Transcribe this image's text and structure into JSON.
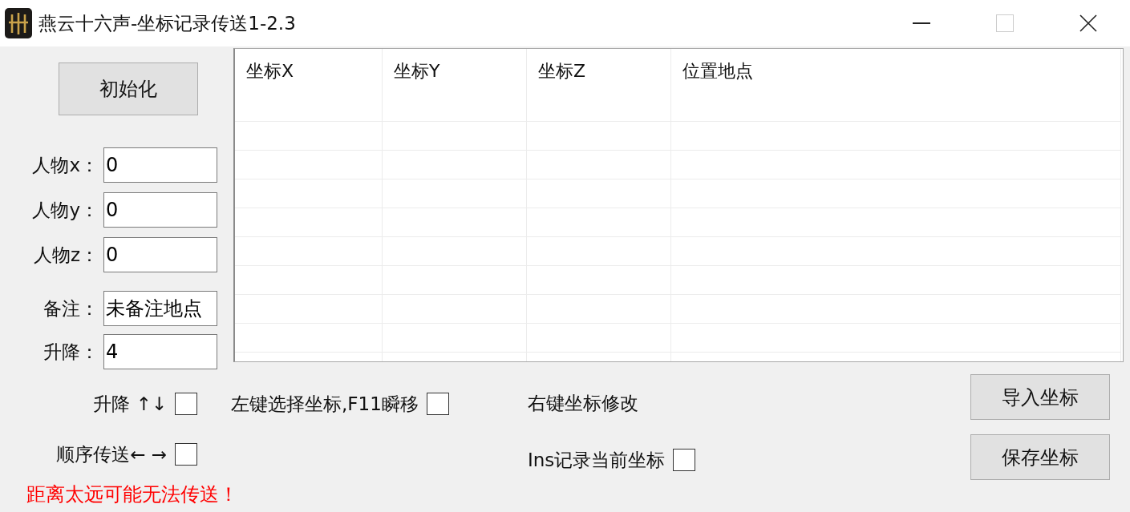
{
  "window": {
    "title": "燕云十六声-坐标记录传送1-2.3",
    "controls": [
      {
        "kind": "minimize",
        "disabled": false
      },
      {
        "kind": "maximize",
        "disabled": true
      },
      {
        "kind": "close",
        "disabled": false
      }
    ]
  },
  "init_button": {
    "label": "初始化"
  },
  "position_fields": [
    {
      "label": "人物x：",
      "value": "0"
    },
    {
      "label": "人物y：",
      "value": "0"
    },
    {
      "label": "人物z：",
      "value": "0"
    }
  ],
  "extra_fields": [
    {
      "label": "备注：",
      "value": "未备注地点"
    },
    {
      "label": "升降：",
      "value": "4"
    }
  ],
  "table": {
    "columns": [
      "坐标X",
      "坐标Y",
      "坐标Z",
      "位置地点"
    ]
  },
  "options": {
    "columns": [
      {
        "items": [
          {
            "kind": "checkbox",
            "label": "升降 ↑↓",
            "checked": false
          },
          {
            "kind": "checkbox",
            "label": "顺序传送← →",
            "checked": false
          }
        ]
      },
      {
        "items": [
          {
            "kind": "checkbox",
            "label": "左键选择坐标,F11瞬移",
            "checked": false
          }
        ]
      },
      {
        "items": [
          {
            "kind": "note",
            "label": "右键坐标修改"
          },
          {
            "kind": "checkbox",
            "label": "Ins记录当前坐标",
            "checked": false
          }
        ]
      }
    ]
  },
  "action_buttons": [
    {
      "label": "导入坐标"
    },
    {
      "label": "保存坐标"
    }
  ],
  "warning": {
    "text": "距离太远可能无法传送！"
  }
}
